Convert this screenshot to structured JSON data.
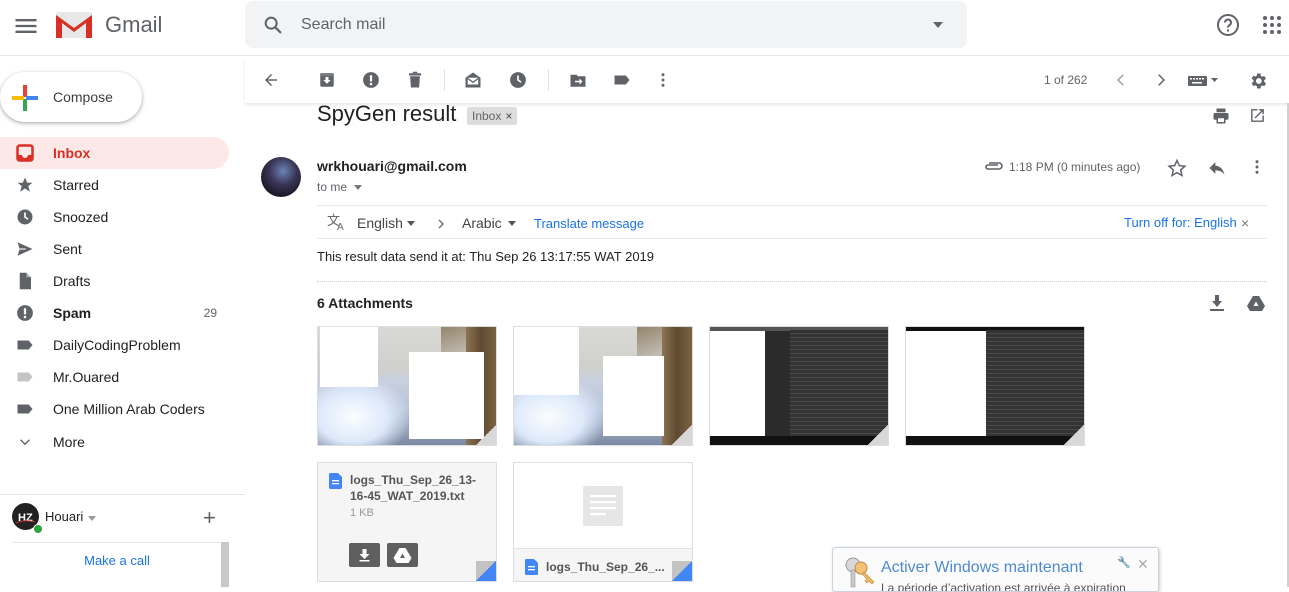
{
  "header": {
    "brand": "Gmail",
    "search_placeholder": "Search mail",
    "icons": [
      "menu-icon",
      "gmail-logo",
      "search-icon",
      "search-options-icon",
      "help-icon",
      "apps-icon"
    ]
  },
  "sidebar": {
    "compose_label": "Compose",
    "items": [
      {
        "label": "Inbox",
        "icon": "inbox-icon",
        "active": true,
        "count": ""
      },
      {
        "label": "Starred",
        "icon": "star-icon",
        "count": ""
      },
      {
        "label": "Snoozed",
        "icon": "clock-icon",
        "count": ""
      },
      {
        "label": "Sent",
        "icon": "send-icon",
        "count": ""
      },
      {
        "label": "Drafts",
        "icon": "draft-icon",
        "count": ""
      },
      {
        "label": "Spam",
        "icon": "spam-icon",
        "count": "29",
        "bold": true
      },
      {
        "label": "DailyCodingProblem",
        "icon": "label-icon",
        "count": ""
      },
      {
        "label": "Mr.Ouared",
        "icon": "label-icon",
        "count": ""
      },
      {
        "label": "One Million Arab Coders",
        "icon": "label-icon",
        "count": ""
      },
      {
        "label": "More",
        "icon": "chevron-down-icon",
        "count": ""
      }
    ],
    "hangouts": {
      "user_name": "Houari",
      "avatar_text": "HZ",
      "call_link": "Make a call"
    }
  },
  "toolbar": {
    "pager": "1 of 262",
    "icons": [
      "back-icon",
      "archive-icon",
      "report-spam-icon",
      "delete-icon",
      "mark-unread-icon",
      "snooze-icon",
      "move-to-icon",
      "labels-icon",
      "more-icon",
      "prev-icon",
      "next-icon",
      "input-tools-icon",
      "settings-icon"
    ]
  },
  "message": {
    "subject": "SpyGen result",
    "label_chip": "Inbox",
    "sender": "wrkhouari@gmail.com",
    "recipient": "to me",
    "time": "1:18 PM (0 minutes ago)",
    "translate": {
      "from": "English",
      "to": "Arabic",
      "translate_link": "Translate message",
      "turn_off": "Turn off for: English"
    },
    "body": "This result data send it at: Thu Sep 26 13:17:55 WAT 2019",
    "attachments_title": "6 Attachments",
    "attachments": [
      {
        "type": "image",
        "kind": "photo"
      },
      {
        "type": "image",
        "kind": "photo"
      },
      {
        "type": "image",
        "kind": "screenshot"
      },
      {
        "type": "image",
        "kind": "screenshot"
      },
      {
        "type": "file",
        "name": "logs_Thu_Sep_26_13-16-45_WAT_2019.txt",
        "size": "1 KB"
      },
      {
        "type": "file",
        "name": "logs_Thu_Sep_26_..."
      }
    ]
  },
  "windows_toast": {
    "title": "Activer Windows maintenant",
    "subtitle": "La période d’activation est arrivée à expiration"
  }
}
